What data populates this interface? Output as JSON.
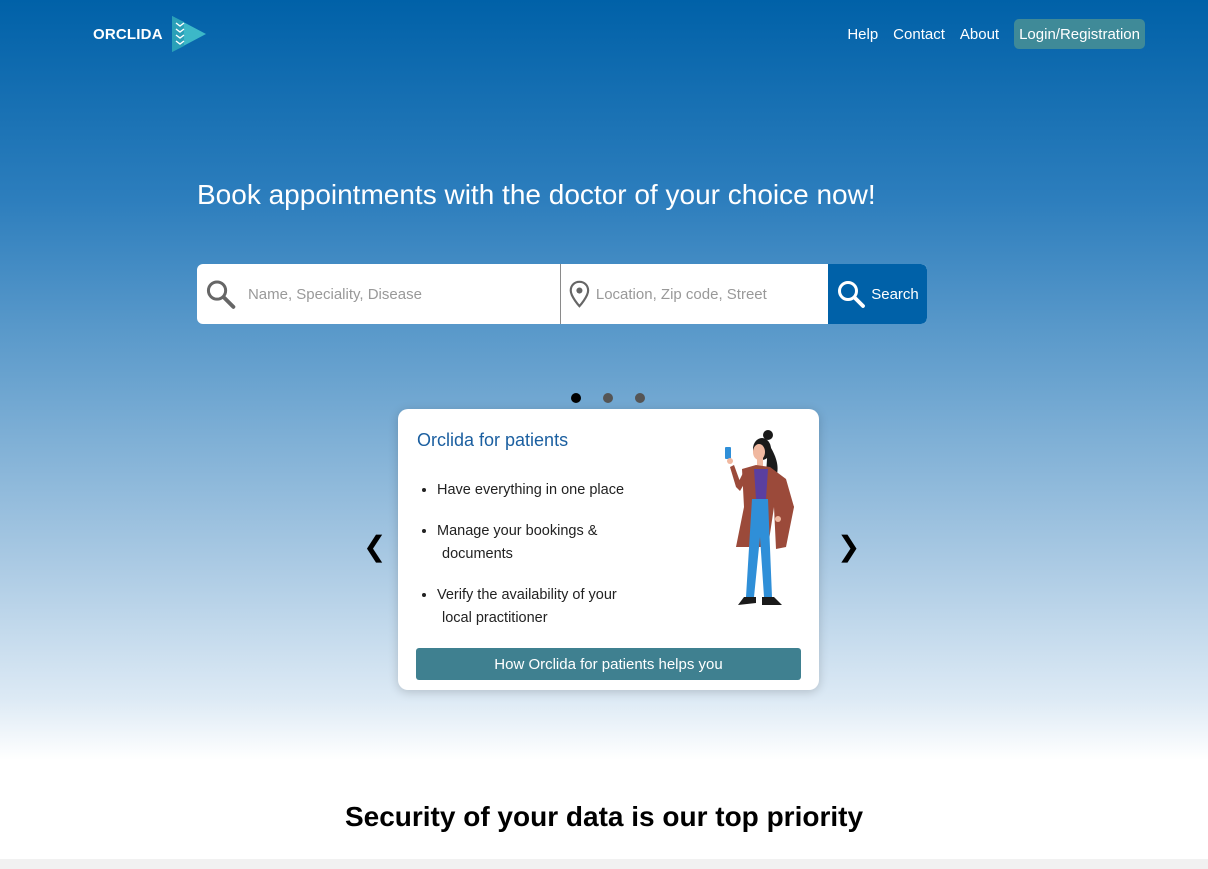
{
  "header": {
    "logo_text": "ORCLIDA",
    "nav": [
      {
        "label": "Help"
      },
      {
        "label": "Contact"
      },
      {
        "label": "About"
      }
    ],
    "login_label": "Login/Registration"
  },
  "hero": {
    "title": "Book appointments with the doctor of your choice now!"
  },
  "search": {
    "name_placeholder": "Name, Speciality, Disease",
    "location_placeholder": "Location, Zip code, Street",
    "button_label": "Search",
    "name_icon": "search-icon",
    "location_icon": "map-pin-icon"
  },
  "carousel": {
    "dots": 3,
    "active_index": 0,
    "prev_glyph": "❮",
    "next_glyph": "❯",
    "card": {
      "title": "Orclida for patients",
      "items": [
        {
          "line1": "Have everything in one place",
          "line2": ""
        },
        {
          "line1": "Manage your bookings &",
          "line2": "documents"
        },
        {
          "line1": "Verify the availability of your",
          "line2": "local practitioner"
        }
      ],
      "cta_label": "How Orclida for patients helps you"
    }
  },
  "security": {
    "title": "Security of your data is our top priority"
  },
  "colors": {
    "brand_blue": "#0061a8",
    "teal_button": "#3f8a98",
    "card_title": "#1b5fa0"
  }
}
